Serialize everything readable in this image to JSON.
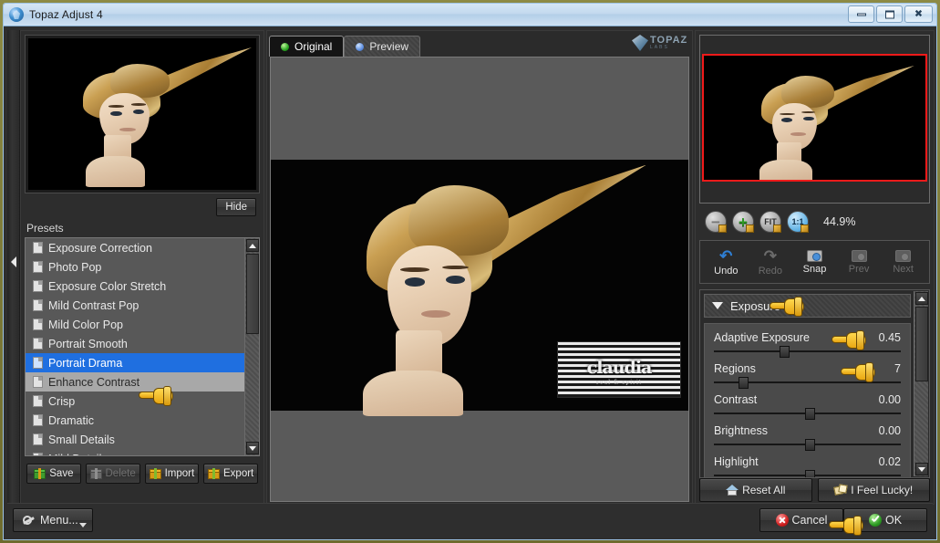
{
  "window": {
    "title": "Topaz Adjust 4",
    "icon": "topaz-app-icon",
    "minimize_label": "Minimize",
    "maximize_label": "Maximize",
    "close_label": "Close"
  },
  "left_panel": {
    "hide_button": "Hide",
    "presets_label": "Presets",
    "presets": [
      {
        "label": "Exposure Correction",
        "state": "normal"
      },
      {
        "label": "Photo Pop",
        "state": "normal"
      },
      {
        "label": "Exposure Color Stretch",
        "state": "normal"
      },
      {
        "label": "Mild Contrast Pop",
        "state": "normal"
      },
      {
        "label": "Mild Color Pop",
        "state": "normal"
      },
      {
        "label": "Portrait Smooth",
        "state": "normal"
      },
      {
        "label": "Portrait Drama",
        "state": "selected"
      },
      {
        "label": "Enhance Contrast",
        "state": "hover"
      },
      {
        "label": "Crisp",
        "state": "normal"
      },
      {
        "label": "Dramatic",
        "state": "normal"
      },
      {
        "label": "Small Details",
        "state": "normal"
      },
      {
        "label": "Mild Details",
        "state": "normal"
      }
    ],
    "buttons": [
      {
        "label": "Save",
        "icon": "save-gift-icon",
        "enabled": true
      },
      {
        "label": "Delete",
        "icon": "delete-gift-icon",
        "enabled": false
      },
      {
        "label": "Import",
        "icon": "import-gift-icon",
        "enabled": true
      },
      {
        "label": "Export",
        "icon": "export-gift-icon",
        "enabled": true
      }
    ]
  },
  "center_panel": {
    "tabs": [
      {
        "label": "Original",
        "dot": "green",
        "active": true
      },
      {
        "label": "Preview",
        "dot": "blue",
        "active": false
      }
    ],
    "brand": {
      "name": "TOPAZ",
      "sub": "LABS"
    },
    "watermark": {
      "name": "claudia",
      "sub": "soul & spirit"
    }
  },
  "right_panel": {
    "zoom": {
      "out_label": "Zoom Out",
      "in_label": "Zoom In",
      "fit_label": "FIT",
      "one_to_one_label": "1:1",
      "value": "44.9%"
    },
    "toolbar": [
      {
        "label": "Undo",
        "icon": "undo-arrow-icon",
        "enabled": true
      },
      {
        "label": "Redo",
        "icon": "redo-arrow-icon",
        "enabled": false
      },
      {
        "label": "Snap",
        "icon": "camera-icon",
        "enabled": true
      },
      {
        "label": "Prev",
        "icon": "camera-prev-icon",
        "enabled": false
      },
      {
        "label": "Next",
        "icon": "camera-next-icon",
        "enabled": false
      }
    ],
    "section": {
      "title": "Exposure",
      "expanded": true
    },
    "sliders": [
      {
        "name": "Adaptive Exposure",
        "value": "0.45",
        "pos_pct": 35
      },
      {
        "name": "Regions",
        "value": "7",
        "pos_pct": 13
      },
      {
        "name": "Contrast",
        "value": "0.00",
        "pos_pct": 49
      },
      {
        "name": "Brightness",
        "value": "0.00",
        "pos_pct": 49
      },
      {
        "name": "Highlight",
        "value": "0.02",
        "pos_pct": 49
      }
    ],
    "actions": [
      {
        "label": "Reset All",
        "icon": "house-icon"
      },
      {
        "label": "I Feel Lucky!",
        "icon": "dice-icon"
      }
    ]
  },
  "footer": {
    "menu_label": "Menu...",
    "cancel_label": "Cancel",
    "ok_label": "OK"
  },
  "colors": {
    "accent_blue": "#1f6fe0",
    "nav_rect_red": "#ef1a1a",
    "titlebar": "#c3d9ee",
    "panel_bg": "#2d2d2d"
  }
}
